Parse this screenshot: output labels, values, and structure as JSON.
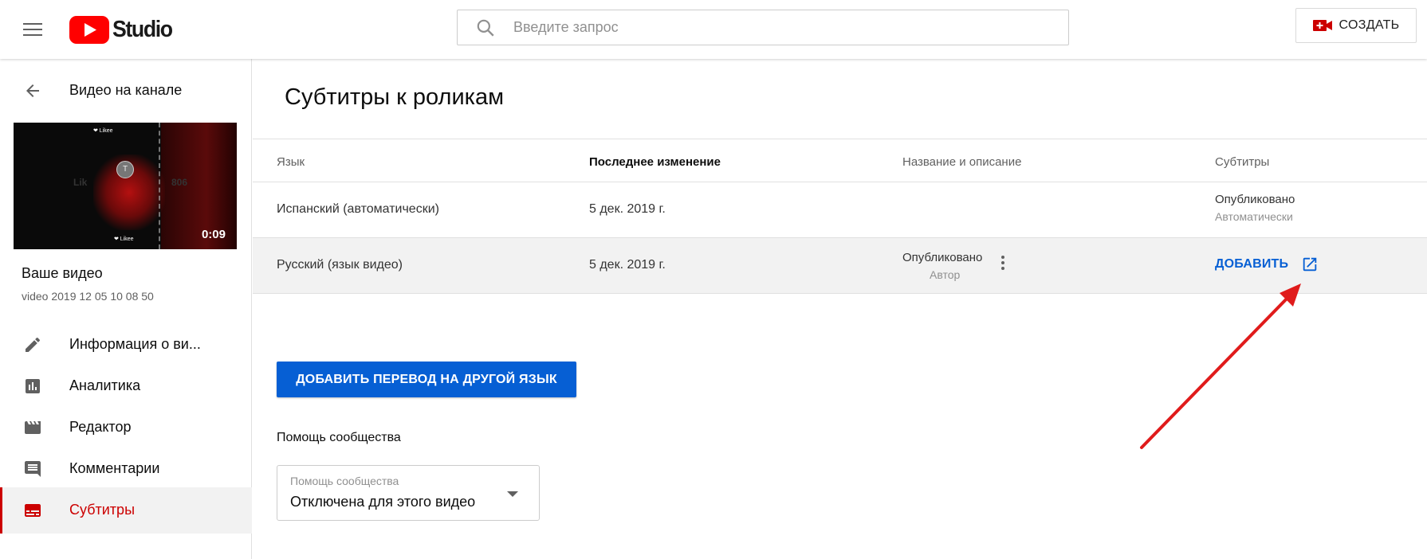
{
  "header": {
    "logo_text": "Studio",
    "search_placeholder": "Введите запрос",
    "create_label": "СОЗДАТЬ"
  },
  "sidebar": {
    "back_label": "Видео на канале",
    "thumbnail": {
      "duration": "0:09",
      "avatar_letter": "T",
      "watermark_left": "Lik",
      "watermark_right": "806",
      "likee_top": "❤ Likee",
      "likee_bottom": "❤ Likee"
    },
    "your_video_label": "Ваше видео",
    "video_name": "video 2019 12 05 10 08 50",
    "items": [
      {
        "label": "Информация о ви...",
        "icon": "pencil-icon",
        "active": false
      },
      {
        "label": "Аналитика",
        "icon": "analytics-icon",
        "active": false
      },
      {
        "label": "Редактор",
        "icon": "clapperboard-icon",
        "active": false
      },
      {
        "label": "Комментарии",
        "icon": "comment-icon",
        "active": false
      },
      {
        "label": "Субтитры",
        "icon": "subtitles-icon",
        "active": true
      }
    ]
  },
  "main": {
    "title": "Субтитры к роликам",
    "table": {
      "headers": [
        "Язык",
        "Последнее изменение",
        "Название и описание",
        "Субтитры"
      ],
      "rows": [
        {
          "language": "Испанский (автоматически)",
          "modified": "5 дек. 2019 г.",
          "title_desc_status": "",
          "title_desc_sub": "",
          "subtitles_status": "Опубликовано",
          "subtitles_sub": "Автоматически"
        },
        {
          "language": "Русский (язык видео)",
          "modified": "5 дек. 2019 г.",
          "title_desc_status": "Опубликовано",
          "title_desc_sub": "Автор",
          "subtitles_action": "ДОБАВИТЬ"
        }
      ]
    },
    "add_translation_label": "ДОБАВИТЬ ПЕРЕВОД НА ДРУГОЙ ЯЗЫК",
    "community": {
      "title": "Помощь сообщества",
      "select_caption": "Помощь сообщества",
      "select_value": "Отключена для этого видео"
    }
  },
  "colors": {
    "accent_blue": "#065fd4",
    "brand_red": "#ff0000",
    "active_red": "#cc0000",
    "annotation_arrow": "#e01b1b"
  }
}
